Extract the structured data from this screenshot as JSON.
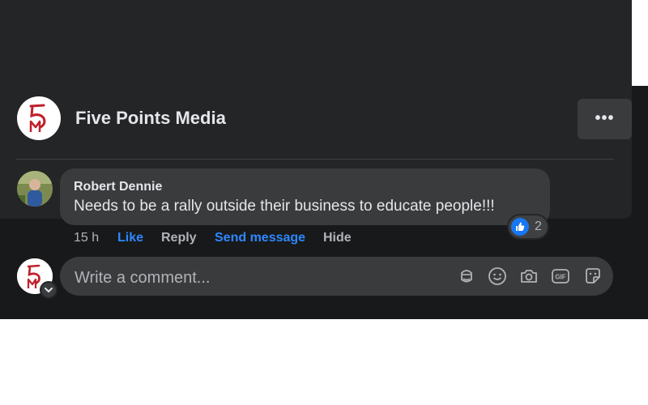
{
  "post": {
    "page_name": "Five Points Media",
    "more_options_label": "•••"
  },
  "comment": {
    "author": "Robert Dennie",
    "text": "Needs to be a rally outside their business to educate people!!!",
    "timestamp": "15 h",
    "like_label": "Like",
    "reply_label": "Reply",
    "send_message_label": "Send message",
    "hide_label": "Hide",
    "reaction_count": "2",
    "reaction_type": "like-icon"
  },
  "composer": {
    "placeholder": "Write a comment...",
    "tools": [
      "avatar-sticker-icon",
      "emoji-icon",
      "camera-icon",
      "gif-icon",
      "sticker-icon"
    ]
  },
  "colors": {
    "link": "#2d88ff",
    "like_badge": "#1877f2",
    "brand_red": "#c0202a"
  }
}
